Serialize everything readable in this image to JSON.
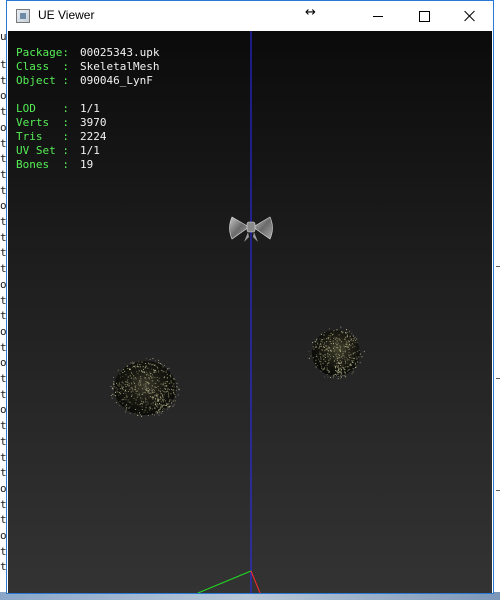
{
  "window": {
    "title": "UE Viewer",
    "resize_glyph": "↔",
    "accent_color": "#2b79d6"
  },
  "info": {
    "package_label": "Package:",
    "package": "00025343.upk",
    "class_label": "Class  :",
    "class": "SkeletalMesh",
    "object_label": "Object :",
    "object": "090046_LynF",
    "lod_label": "LOD    :",
    "lod": "1/1",
    "verts_label": "Verts  :",
    "verts": "3970",
    "tris_label": "Tris   :",
    "tris": "2224",
    "uvset_label": "UV Set :",
    "uvset": "1/1",
    "bones_label": "Bones  :",
    "bones": "19",
    "label_color": "#55ee55",
    "value_color": "#f2f2f2"
  },
  "scene": {
    "axis_colors": {
      "x": "#ff2a2a",
      "y": "#22dd22",
      "z": "#2a2aff"
    },
    "objects": [
      "bow-mesh",
      "fur-pompom-left",
      "fur-pompom-right"
    ]
  },
  "background_app": {
    "left_column_letters": [
      "u",
      "t",
      "t",
      "o",
      "t",
      "o",
      "t",
      "t",
      "t",
      "t",
      "o",
      "t",
      "t",
      "t",
      "t",
      "o",
      "t",
      "t",
      "o",
      "t",
      "o",
      "t",
      "t",
      "o",
      "t",
      "t",
      "t",
      "t",
      "o",
      "t",
      "t",
      "o",
      "t",
      "t"
    ]
  }
}
